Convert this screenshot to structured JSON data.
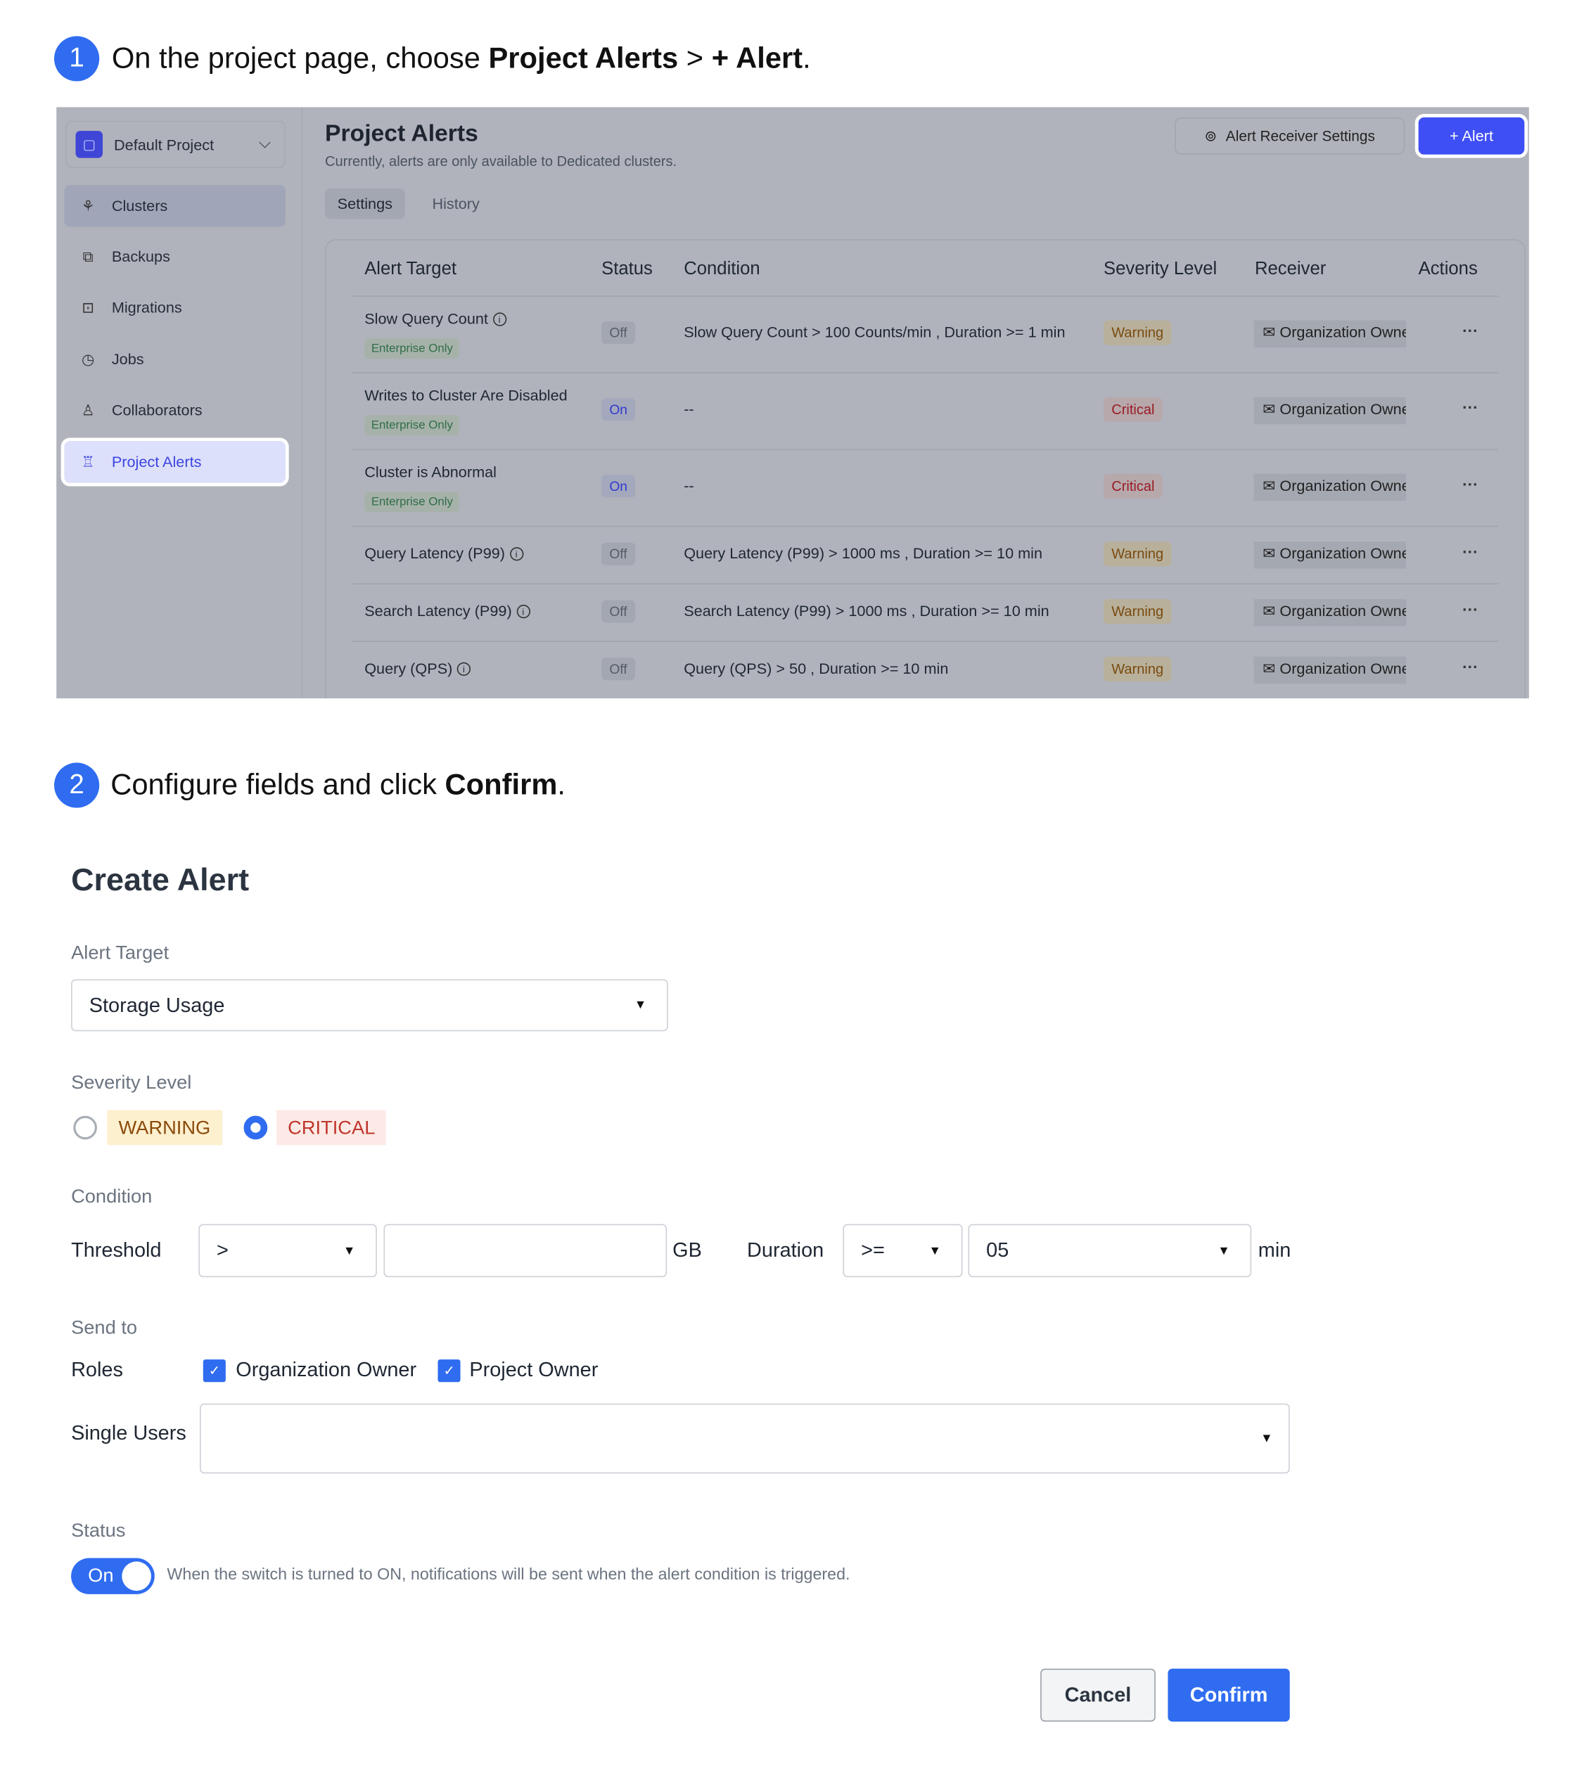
{
  "steps": [
    {
      "number": "1",
      "text_before": "On the project page, choose ",
      "bold1": "Project Alerts",
      "mid": " > ",
      "bold2": "+ Alert",
      "after": "."
    },
    {
      "number": "2",
      "text_before": "Configure fields and click ",
      "bold1": "Confirm",
      "after": "."
    }
  ],
  "screenshot": {
    "project": "Default Project",
    "nav": [
      {
        "label": "Clusters",
        "icon": "clusters-icon"
      },
      {
        "label": "Backups",
        "icon": "backups-icon"
      },
      {
        "label": "Migrations",
        "icon": "migrations-icon"
      },
      {
        "label": "Jobs",
        "icon": "jobs-icon"
      },
      {
        "label": "Collaborators",
        "icon": "collaborators-icon"
      },
      {
        "label": "Project Alerts",
        "icon": "alarm-icon"
      }
    ],
    "title": "Project Alerts",
    "subtitle": "Currently, alerts are only available to Dedicated clusters.",
    "tabs": [
      "Settings",
      "History"
    ],
    "receiver_settings_label": "Alert Receiver Settings",
    "add_alert_label": "+ Alert",
    "columns": [
      "Alert Target",
      "Status",
      "Condition",
      "Severity Level",
      "Receiver",
      "Actions"
    ],
    "rows": [
      {
        "target": "Slow Query Count",
        "info": true,
        "enterprise": "Enterprise Only",
        "status": "Off",
        "condition": "Slow Query Count > 100 Counts/min , Duration >= 1 min",
        "severity": "Warning",
        "receiver": "Organization Owner"
      },
      {
        "target": "Writes to Cluster Are Disabled",
        "info": false,
        "enterprise": "Enterprise Only",
        "status": "On",
        "condition": "--",
        "severity": "Critical",
        "receiver": "Organization Owner"
      },
      {
        "target": "Cluster is Abnormal",
        "info": false,
        "enterprise": "Enterprise Only",
        "status": "On",
        "condition": "--",
        "severity": "Critical",
        "receiver": "Organization Owner"
      },
      {
        "target": "Query Latency (P99)",
        "info": true,
        "enterprise": "",
        "status": "Off",
        "condition": "Query Latency (P99) > 1000 ms , Duration >= 10 min",
        "severity": "Warning",
        "receiver": "Organization Owner"
      },
      {
        "target": "Search Latency (P99)",
        "info": true,
        "enterprise": "",
        "status": "Off",
        "condition": "Search Latency (P99) > 1000 ms , Duration >= 10 min",
        "severity": "Warning",
        "receiver": "Organization Owner"
      },
      {
        "target": "Query (QPS)",
        "info": true,
        "enterprise": "",
        "status": "Off",
        "condition": "Query (QPS) > 50 , Duration >= 10 min",
        "severity": "Warning",
        "receiver": "Organization Owner"
      }
    ]
  },
  "form": {
    "title": "Create Alert",
    "alert_target_label": "Alert Target",
    "alert_target_value": "Storage Usage",
    "severity_label": "Severity Level",
    "severity_options": [
      "WARNING",
      "CRITICAL"
    ],
    "severity_selected": "CRITICAL",
    "condition_label": "Condition",
    "threshold_label": "Threshold",
    "threshold_operator": ">",
    "threshold_value": "",
    "threshold_unit": "GB",
    "duration_label": "Duration",
    "duration_operator": ">=",
    "duration_value": "05",
    "duration_unit": "min",
    "send_to_label": "Send to",
    "roles_label": "Roles",
    "roles": [
      {
        "label": "Organization Owner",
        "checked": true
      },
      {
        "label": "Project Owner",
        "checked": true
      }
    ],
    "single_users_label": "Single Users",
    "status_label": "Status",
    "status_toggle": "On",
    "status_hint": "When the switch is turned to ON, notifications will be sent when the alert condition is triggered.",
    "cancel_label": "Cancel",
    "confirm_label": "Confirm"
  },
  "colors": {
    "accent": "#2f6cf0",
    "alert_button": "#3e4ff5",
    "warning_bg": "#fdf0cf",
    "warning_text": "#8a4a0a",
    "critical_bg": "#fdeae6",
    "critical_text": "#c0352b"
  }
}
